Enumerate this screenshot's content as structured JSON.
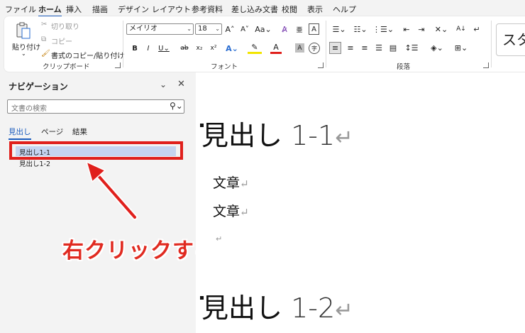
{
  "menu": {
    "tabs": [
      "ファイル",
      "ホーム",
      "挿入",
      "描画",
      "デザイン",
      "レイアウト",
      "参考資料",
      "差し込み文書",
      "校閲",
      "表示",
      "ヘルプ"
    ],
    "active": "ホーム"
  },
  "ribbon": {
    "clipboard": {
      "paste": "貼り付け",
      "cut": "切り取り",
      "copy": "コピー",
      "format_painter": "書式のコピー/貼り付け",
      "label": "クリップボード"
    },
    "font": {
      "family": "メイリオ",
      "size": "18",
      "label": "フォント"
    },
    "paragraph": {
      "label": "段落"
    },
    "styles": {
      "preview": "スタ"
    }
  },
  "nav": {
    "title": "ナビゲーション",
    "search_placeholder": "文書の検索",
    "tabs": [
      "見出し",
      "ページ",
      "結果"
    ],
    "headings": [
      "見出し1-1",
      "見出し1-2"
    ]
  },
  "annotation": {
    "callout": "右クリックする"
  },
  "document": {
    "heading1": "見出し",
    "heading1_num": "1-1",
    "para1": "文章",
    "para2": "文章",
    "heading2": "見出し",
    "heading2_num": "1-2"
  }
}
